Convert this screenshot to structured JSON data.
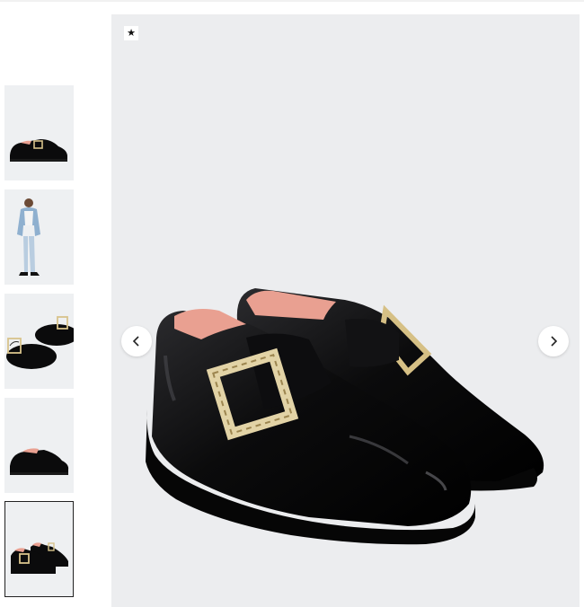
{
  "badge": {
    "icon": "star-icon",
    "glyph": "★"
  },
  "gallery": {
    "thumbnails": [
      {
        "name": "thumb-side-view",
        "active": false
      },
      {
        "name": "thumb-model-wearing",
        "active": false
      },
      {
        "name": "thumb-top-view",
        "active": false
      },
      {
        "name": "thumb-rear-view",
        "active": false
      },
      {
        "name": "thumb-pair-view",
        "active": true
      }
    ],
    "prev_icon": "chevron-left-icon",
    "next_icon": "chevron-right-icon"
  },
  "colors": {
    "viewer_bg": "#ecedef",
    "patent_black": "#0b0b0c",
    "lining_pink": "#e9a091",
    "buckle_gold": "#c9b27a"
  }
}
